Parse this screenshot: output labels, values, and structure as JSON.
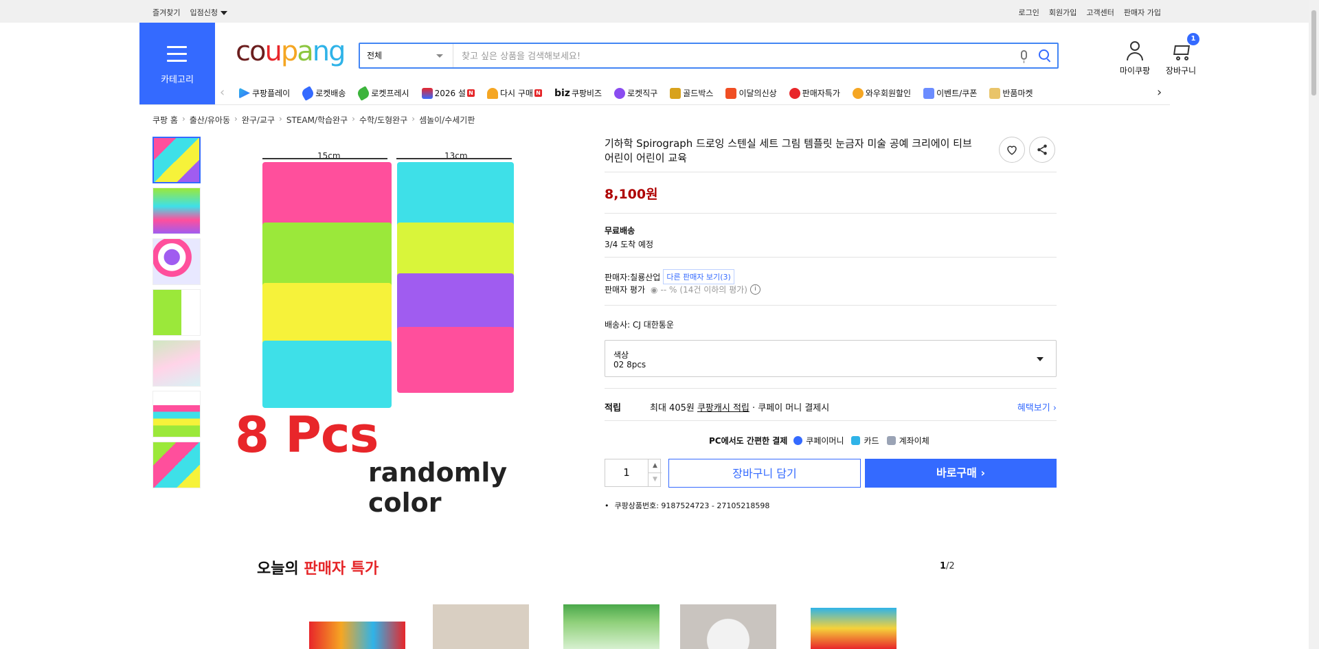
{
  "topbar": {
    "left": [
      "즐겨찾기",
      "입점신청"
    ],
    "right": [
      "로그인",
      "회원가입",
      "고객센터",
      "판매자 가입"
    ]
  },
  "header": {
    "category_label": "카테고리",
    "logo_text": "coupang",
    "search": {
      "category": "전체",
      "placeholder": "찾고 싶은 상품을 검색해보세요!"
    },
    "my_label": "마이쿠팡",
    "cart_label": "장바구니",
    "cart_count": "1"
  },
  "nav": {
    "items": [
      "쿠팡플레이",
      "로켓배송",
      "로켓프레시",
      "2026 설",
      "다시 구매",
      "쿠팡비즈",
      "로켓직구",
      "골드박스",
      "이달의신상",
      "판매자특가",
      "와우회원할인",
      "이벤트/쿠폰",
      "반품마켓"
    ],
    "biz_prefix": "biz",
    "new_badge": "N"
  },
  "breadcrumb": [
    "쿠팡 홈",
    "출산/유아동",
    "완구/교구",
    "STEAM/학습완구",
    "수학/도형완구",
    "셈놀이/수세기판"
  ],
  "product": {
    "title": "기하학 Spirograph 드로잉 스텐실 세트 그림 템플릿 눈금자 미술 공예 크리에이 티브 어린이 어린이 교육",
    "price": "8,100원",
    "image_text": {
      "ruler_left": "15cm",
      "ruler_right": "13cm",
      "big": "8 Pcs",
      "small": "randomly color"
    },
    "delivery_title": "무료배송",
    "delivery_date": "3/4 도착 예정",
    "seller_label": "판매자:",
    "seller_name": "칠룡산업",
    "other_sellers": "다른 판매자 보기",
    "other_sellers_count": "(3)",
    "seller_rating_label": "판매자 평가",
    "seller_rating_value": "-- %",
    "seller_rating_note": "(14건 이하의 평가)",
    "shipper": "배송사:  CJ 대한통운",
    "option_label": "색상",
    "option_value": "02 8pcs",
    "reward_label": "적립",
    "reward_prefix": "최대 405원 ",
    "reward_link": "쿠팡캐시 적립",
    "reward_suffix": " · 쿠페이 머니 결제시",
    "reward_more": "혜택보기",
    "pay_title": "PC에서도 간편한 결제",
    "pay_methods": [
      "쿠페이머니",
      "카드",
      "계좌이체"
    ],
    "quantity": "1",
    "add_to_cart": "장바구니 담기",
    "buy_now": "바로구매",
    "product_id": "쿠팡상품번호: 9187524723 - 27105218598"
  },
  "deals": {
    "title_prefix": "오늘의 ",
    "title_highlight": "판매자 특가",
    "page_current": "1",
    "page_total": "/2"
  },
  "colors": {
    "accent": "#346aff",
    "price": "#ae0000",
    "deal_red": "#e52528",
    "stencil_pink": "#ff4f9c",
    "stencil_cyan": "#3ee0e8",
    "stencil_green": "#9be83a",
    "stencil_yellow": "#f6f23a",
    "stencil_purple": "#a05cf0"
  }
}
